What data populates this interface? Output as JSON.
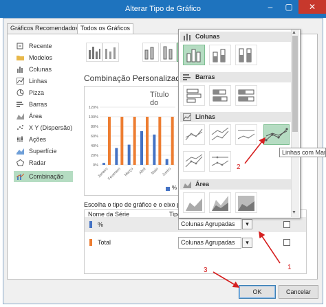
{
  "window": {
    "title": "Alterar Tipo de Gráfico",
    "minimize": "–",
    "maximize": "▢",
    "close": "✕"
  },
  "tabs": [
    "Gráficos Recomendados",
    "Todos os Gráficos"
  ],
  "nav": [
    "Recente",
    "Modelos",
    "Colunas",
    "Linhas",
    "Pizza",
    "Barras",
    "Área",
    "X Y (Dispersão)",
    "Ações",
    "Superfície",
    "Radar",
    "Combinação"
  ],
  "main": {
    "heading": "Combinação Personalizada",
    "preview_title": "Título do",
    "legend_label": "%",
    "series_prompt": "Escolha o tipo de gráfico e o eixo para",
    "col_series_name": "Nome da Série",
    "col_type": "Tipo",
    "rows": [
      {
        "name": "%",
        "color": "#4472c4",
        "type": "Colunas Agrupadas"
      },
      {
        "name": "Total",
        "color": "#ed7d31",
        "type": "Colunas Agrupadas"
      }
    ]
  },
  "popup": {
    "sections": [
      "Colunas",
      "Barras",
      "Linhas",
      "Área"
    ],
    "tooltip": "Linhas com Marc"
  },
  "buttons": {
    "ok": "OK",
    "cancel": "Cancelar"
  },
  "annotations": {
    "one": "1",
    "two": "2",
    "three": "3"
  },
  "colors": {
    "accent": "#1e73be",
    "selected": "#b5dcc2",
    "series1": "#4472c4",
    "series2": "#ed7d31",
    "annotation": "#d62020"
  },
  "chart_data": {
    "type": "bar",
    "title": "Título do",
    "categories": [
      "Janeiro",
      "Fevereiro",
      "Março",
      "Abril",
      "Maio",
      "Junho"
    ],
    "series": [
      {
        "name": "%",
        "values": [
          0.04,
          0.35,
          0.42,
          0.7,
          0.63,
          0.12
        ]
      },
      {
        "name": "Total",
        "values": [
          1.0,
          1.0,
          1.0,
          1.0,
          1.0,
          1.0
        ]
      }
    ],
    "yticks": [
      "120%",
      "100%",
      "80%",
      "60%",
      "40%",
      "20%",
      "0%"
    ],
    "ylim": [
      0,
      1.2
    ],
    "grid": true
  }
}
